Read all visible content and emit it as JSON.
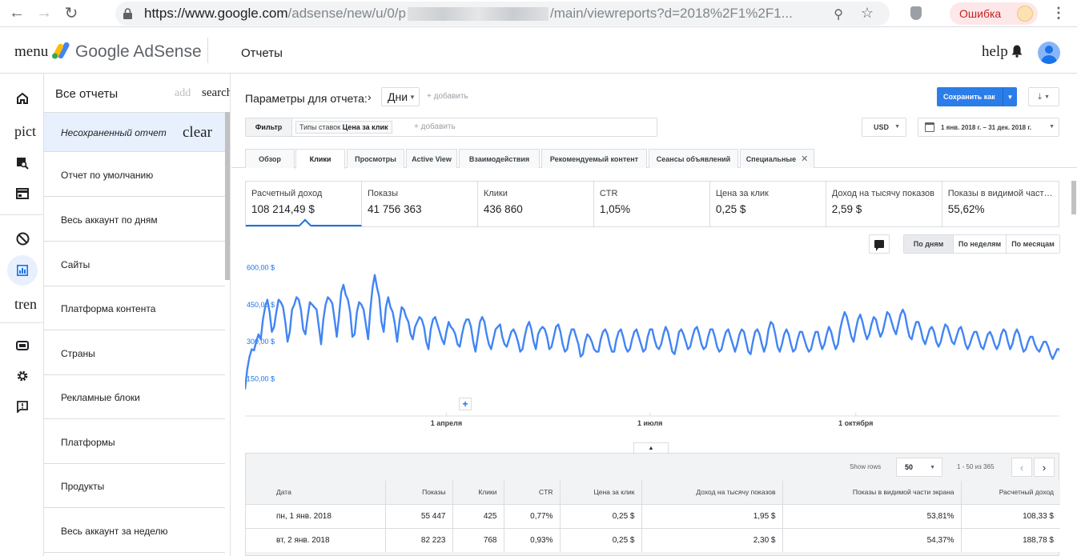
{
  "browser": {
    "url_prefix": "https://www.google.com",
    "url_path_start": "/adsense/new/u/0/p",
    "url_path_end": "/main/viewreports?d=2018%2F1%2F1...",
    "error_label": "Ошибка"
  },
  "appbar": {
    "menu_label": "menu",
    "brand": "Google AdSense",
    "page_title": "Отчеты",
    "help_label": "help"
  },
  "rail": {
    "pict_label": "pict",
    "trend_label": "tren"
  },
  "reports": {
    "all_reports": "Все отчеты",
    "add_label": "add",
    "search_label": "search",
    "selected": "Несохраненный отчет",
    "clear_label": "clear",
    "items": [
      "Отчет по умолчанию",
      "Весь аккаунт по дням",
      "Сайты",
      "Платформа контента",
      "Страны",
      "Рекламные блоки",
      "Платформы",
      "Продукты",
      "Весь аккаунт за неделю"
    ]
  },
  "params": {
    "label": "Параметры для отчета:",
    "dimension": "Дни",
    "add_label": "+ добавить",
    "save_label": "Сохранить как"
  },
  "filter": {
    "button": "Фильтр",
    "chip_prefix": "Типы ставок",
    "chip_value": "Цена за клик",
    "add_label": "+ добавить",
    "currency": "USD",
    "date_range": "1 янв. 2018 г. – 31 дек. 2018 г."
  },
  "tabs": [
    {
      "label": "Обзор"
    },
    {
      "label": "Клики"
    },
    {
      "label": "Просмотры"
    },
    {
      "label": "Active View"
    },
    {
      "label": "Взаимодействия"
    },
    {
      "label": "Рекомендуемый контент"
    },
    {
      "label": "Сеансы объявлений"
    },
    {
      "label": "Специальные"
    }
  ],
  "metrics": [
    {
      "label": "Расчетный доход",
      "value": "108 214,49 $"
    },
    {
      "label": "Показы",
      "value": "41 756 363"
    },
    {
      "label": "Клики",
      "value": "436 860"
    },
    {
      "label": "CTR",
      "value": "1,05%"
    },
    {
      "label": "Цена за клик",
      "value": "0,25 $"
    },
    {
      "label": "Доход на тысячу показов",
      "value": "2,59 $"
    },
    {
      "label": "Показы в видимой части экрана",
      "value": "55,62%"
    }
  ],
  "period": {
    "days": "По дням",
    "weeks": "По неделям",
    "months": "По месяцам"
  },
  "colors": {
    "line": "#4285f4",
    "accent": "#1a73e8",
    "save": "#2b7de9"
  },
  "chart_data": {
    "type": "line",
    "y_tick_labels": [
      "600,00 $",
      "450,00 $",
      "300,00 $",
      "150,00 $"
    ],
    "y_ticks": [
      600,
      450,
      300,
      150
    ],
    "ylim": [
      0,
      640
    ],
    "x_tick_labels": [
      "1 апреля",
      "1 июля",
      "1 октября"
    ],
    "x_ticks": [
      "2018-04-01",
      "2018-07-01",
      "2018-10-01"
    ],
    "xlim": [
      "2018-01-01",
      "2018-12-31"
    ],
    "series": [
      {
        "x_start": "2018-01-01",
        "x_step_days": 1,
        "values": [
          108,
          189,
          240,
          270,
          265,
          300,
          330,
          310,
          390,
          440,
          470,
          420,
          340,
          360,
          420,
          470,
          460,
          440,
          380,
          300,
          340,
          430,
          450,
          480,
          470,
          430,
          350,
          330,
          400,
          460,
          450,
          440,
          430,
          360,
          290,
          390,
          450,
          480,
          470,
          455,
          390,
          320,
          400,
          500,
          530,
          490,
          470,
          420,
          320,
          330,
          420,
          460,
          450,
          430,
          370,
          310,
          430,
          520,
          570,
          520,
          480,
          380,
          340,
          440,
          480,
          440,
          420,
          370,
          300,
          380,
          440,
          430,
          400,
          380,
          330,
          310,
          360,
          380,
          400,
          390,
          360,
          300,
          270,
          350,
          390,
          400,
          370,
          340,
          310,
          290,
          340,
          380,
          360,
          350,
          330,
          290,
          280,
          330,
          370,
          390,
          390,
          360,
          300,
          260,
          320,
          380,
          400,
          380,
          330,
          290,
          270,
          310,
          350,
          360,
          370,
          320,
          290,
          280,
          310,
          340,
          350,
          330,
          300,
          260,
          270,
          320,
          360,
          380,
          350,
          300,
          270,
          330,
          350,
          360,
          350,
          320,
          270,
          280,
          320,
          360,
          370,
          340,
          290,
          260,
          270,
          320,
          350,
          350,
          320,
          290,
          240,
          250,
          300,
          330,
          320,
          300,
          270,
          260,
          260,
          310,
          340,
          350,
          330,
          290,
          260,
          260,
          310,
          340,
          350,
          320,
          280,
          260,
          270,
          310,
          340,
          350,
          320,
          290,
          260,
          270,
          320,
          350,
          350,
          310,
          280,
          270,
          290,
          330,
          360,
          340,
          300,
          260,
          250,
          290,
          340,
          350,
          330,
          300,
          270,
          280,
          320,
          350,
          360,
          330,
          290,
          270,
          280,
          320,
          350,
          350,
          320,
          280,
          260,
          270,
          310,
          340,
          350,
          320,
          290,
          260,
          290,
          330,
          350,
          340,
          300,
          260,
          250,
          300,
          340,
          350,
          330,
          290,
          260,
          290,
          350,
          380,
          370,
          330,
          280,
          260,
          290,
          330,
          350,
          330,
          290,
          260,
          270,
          310,
          340,
          340,
          310,
          280,
          260,
          270,
          310,
          340,
          340,
          300,
          270,
          290,
          330,
          360,
          340,
          300,
          270,
          290,
          350,
          390,
          420,
          400,
          360,
          320,
          300,
          350,
          390,
          410,
          380,
          340,
          310,
          330,
          370,
          400,
          390,
          350,
          320,
          340,
          380,
          420,
          410,
          380,
          350,
          330,
          370,
          410,
          430,
          410,
          360,
          320,
          310,
          350,
          380,
          380,
          350,
          310,
          290,
          320,
          350,
          360,
          340,
          300,
          280,
          300,
          340,
          370,
          360,
          330,
          300,
          290,
          320,
          350,
          360,
          330,
          290,
          270,
          290,
          320,
          340,
          340,
          310,
          280,
          270,
          300,
          330,
          340,
          320,
          290,
          270,
          290,
          330,
          350,
          340,
          300,
          270,
          290,
          330,
          350,
          330,
          290,
          260,
          270,
          300,
          320,
          320,
          290,
          270,
          260,
          280,
          300,
          300,
          280,
          250,
          230,
          250,
          270,
          270,
          240,
          210,
          190,
          170,
          140,
          110
        ]
      }
    ]
  },
  "table": {
    "show_rows_label": "Show rows",
    "rows_per_page": "50",
    "range_label": "1 - 50 из 365",
    "columns": [
      "Дата",
      "Показы",
      "Клики",
      "CTR",
      "Цена за клик",
      "Доход на тысячу показов",
      "Показы в видимой части экрана",
      "Расчетный доход"
    ],
    "rows": [
      [
        "пн, 1 янв. 2018",
        "55 447",
        "425",
        "0,77%",
        "0,25 $",
        "1,95 $",
        "53,81%",
        "108,33 $"
      ],
      [
        "вт, 2 янв. 2018",
        "82 223",
        "768",
        "0,93%",
        "0,25 $",
        "2,30 $",
        "54,37%",
        "188,78 $"
      ]
    ]
  }
}
